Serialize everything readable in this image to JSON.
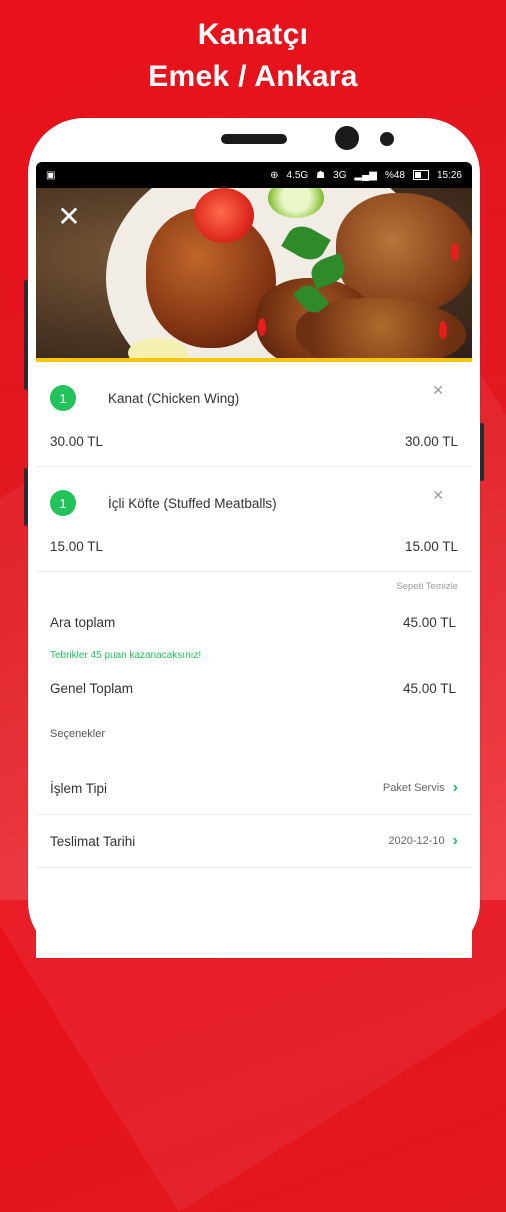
{
  "header": {
    "line1": "Kanatçı",
    "line2": "Emek / Ankara"
  },
  "statusbar": {
    "network": "4.5G",
    "signal": "3G",
    "battery_pct": "%48",
    "time": "15:26"
  },
  "cart": {
    "items": [
      {
        "qty": "1",
        "name": "Kanat (Chicken Wing)",
        "unit_price": "30.00 TL",
        "total_price": "30.00 TL"
      },
      {
        "qty": "1",
        "name": "İçli Köfte (Stuffed Meatballs)",
        "unit_price": "15.00 TL",
        "total_price": "15.00 TL"
      }
    ],
    "clear_label": "Sepeti Temizle",
    "subtotal_label": "Ara toplam",
    "subtotal_value": "45.00 TL",
    "promo_text": "Tebrikler 45 puan kazanacaksınız!",
    "total_label": "Genel Toplam",
    "total_value": "45.00 TL"
  },
  "options": {
    "title": "Seçenekler",
    "rows": [
      {
        "label": "İşlem Tipi",
        "value": "Paket Servis"
      },
      {
        "label": "Teslimat Tarihi",
        "value": "2020-12-10"
      }
    ]
  },
  "colors": {
    "brand_red": "#e8101a",
    "accent_green": "#21c35a",
    "hero_border": "#f7c600"
  }
}
